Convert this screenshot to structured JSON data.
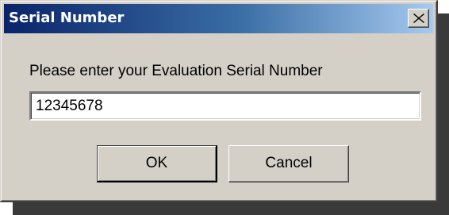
{
  "dialog": {
    "title": "Serial Number",
    "close_icon": "close-icon",
    "prompt": "Please enter your Evaluation Serial Number",
    "serial_value": "12345678",
    "ok_label": "OK",
    "cancel_label": "Cancel"
  },
  "colors": {
    "title_gradient_start": "#0a246a",
    "title_gradient_end": "#a6caf0",
    "dialog_face": "#d4d0c8"
  }
}
